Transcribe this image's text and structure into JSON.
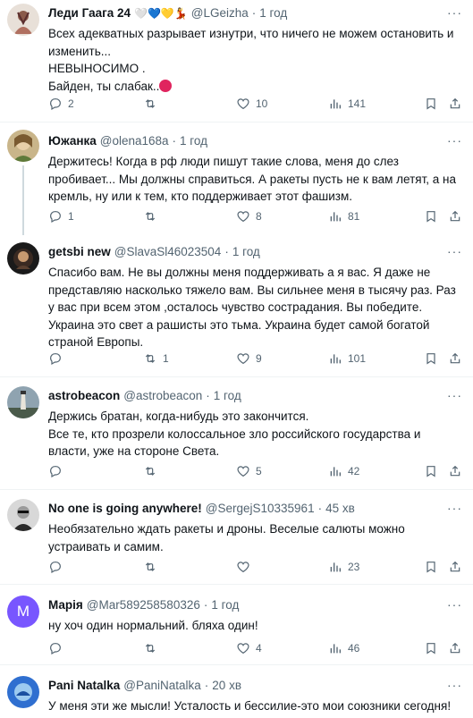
{
  "tweets": [
    {
      "name": "Леди Гаага 24",
      "emojis": "🤍💙💛💃",
      "handle": "@LGeizha",
      "time": "1 год",
      "text": "Всех адекватных разрывает изнутри, что ничего не можем остановить и изменить...\nНЕВЫНОСИМО .\nБайден, ты слабак..",
      "trailing_emoji": "angry-face",
      "replies": "2",
      "retweets": "",
      "likes": "10",
      "views": "141"
    },
    {
      "name": "Южанка",
      "handle": "@olena168a",
      "time": "1 год",
      "text": "Держитесь! Когда в рф люди пишут такие слова, меня до слез пробивает... Мы должны справиться. А ракеты пусть не к вам летят, а на кремль, ну или к тем, кто поддерживает этот фашизм.",
      "replies": "1",
      "retweets": "",
      "likes": "8",
      "views": "81"
    },
    {
      "name": "getsbi new",
      "handle": "@SlavaSl46023504",
      "time": "1 год",
      "text": "Спасибо вам. Не вы должны меня поддерживать а я вас. Я даже не представляю насколько тяжело вам. Вы сильнее меня в тысячу раз. Раз у вас при всем этом ,осталось чувство сострадания. Вы победите. Украина это свет а рашисты это тьма. Украина будет самой богатой страной Европы.",
      "replies": "",
      "retweets": "1",
      "likes": "9",
      "views": "101"
    },
    {
      "name": "astrobeacon",
      "handle": "@astrobeacon",
      "time": "1 год",
      "text": "Держись братан, когда-нибудь это закончится.\nВсе те, кто прозрели колоссальное зло российского государства и власти, уже на стороне Света.",
      "replies": "",
      "retweets": "",
      "likes": "5",
      "views": "42"
    },
    {
      "name": "No one is going anywhere!",
      "handle": "@SergejS10335961",
      "time": "45 хв",
      "text": "Необязательно ждать ракеты и дроны. Веселые салюты можно устраивать и самим.",
      "replies": "",
      "retweets": "",
      "likes": "",
      "views": "23"
    },
    {
      "name": "Марія",
      "avatar_letter": "M",
      "handle": "@Mar589258580326",
      "time": "1 год",
      "text": "ну хоч один нормальний. бляха один!",
      "replies": "",
      "retweets": "",
      "likes": "4",
      "views": "46"
    },
    {
      "name": "Pani Natalka",
      "handle": "@PaniNatalka",
      "time": "20 хв",
      "text": "У меня эти же мысли! Усталость и бессилие-это мои союзники сегодня!"
    }
  ],
  "icons": [
    "reply-icon",
    "retweet-icon",
    "like-icon",
    "views-icon",
    "bookmark-icon",
    "share-icon",
    "more-icon"
  ],
  "more_glyph": "···",
  "colors": {
    "text": "#0f1419",
    "secondary": "#536471",
    "divider": "#eff3f4",
    "thread_line": "#cfd9de",
    "marija_avatar": "#7856ff"
  }
}
